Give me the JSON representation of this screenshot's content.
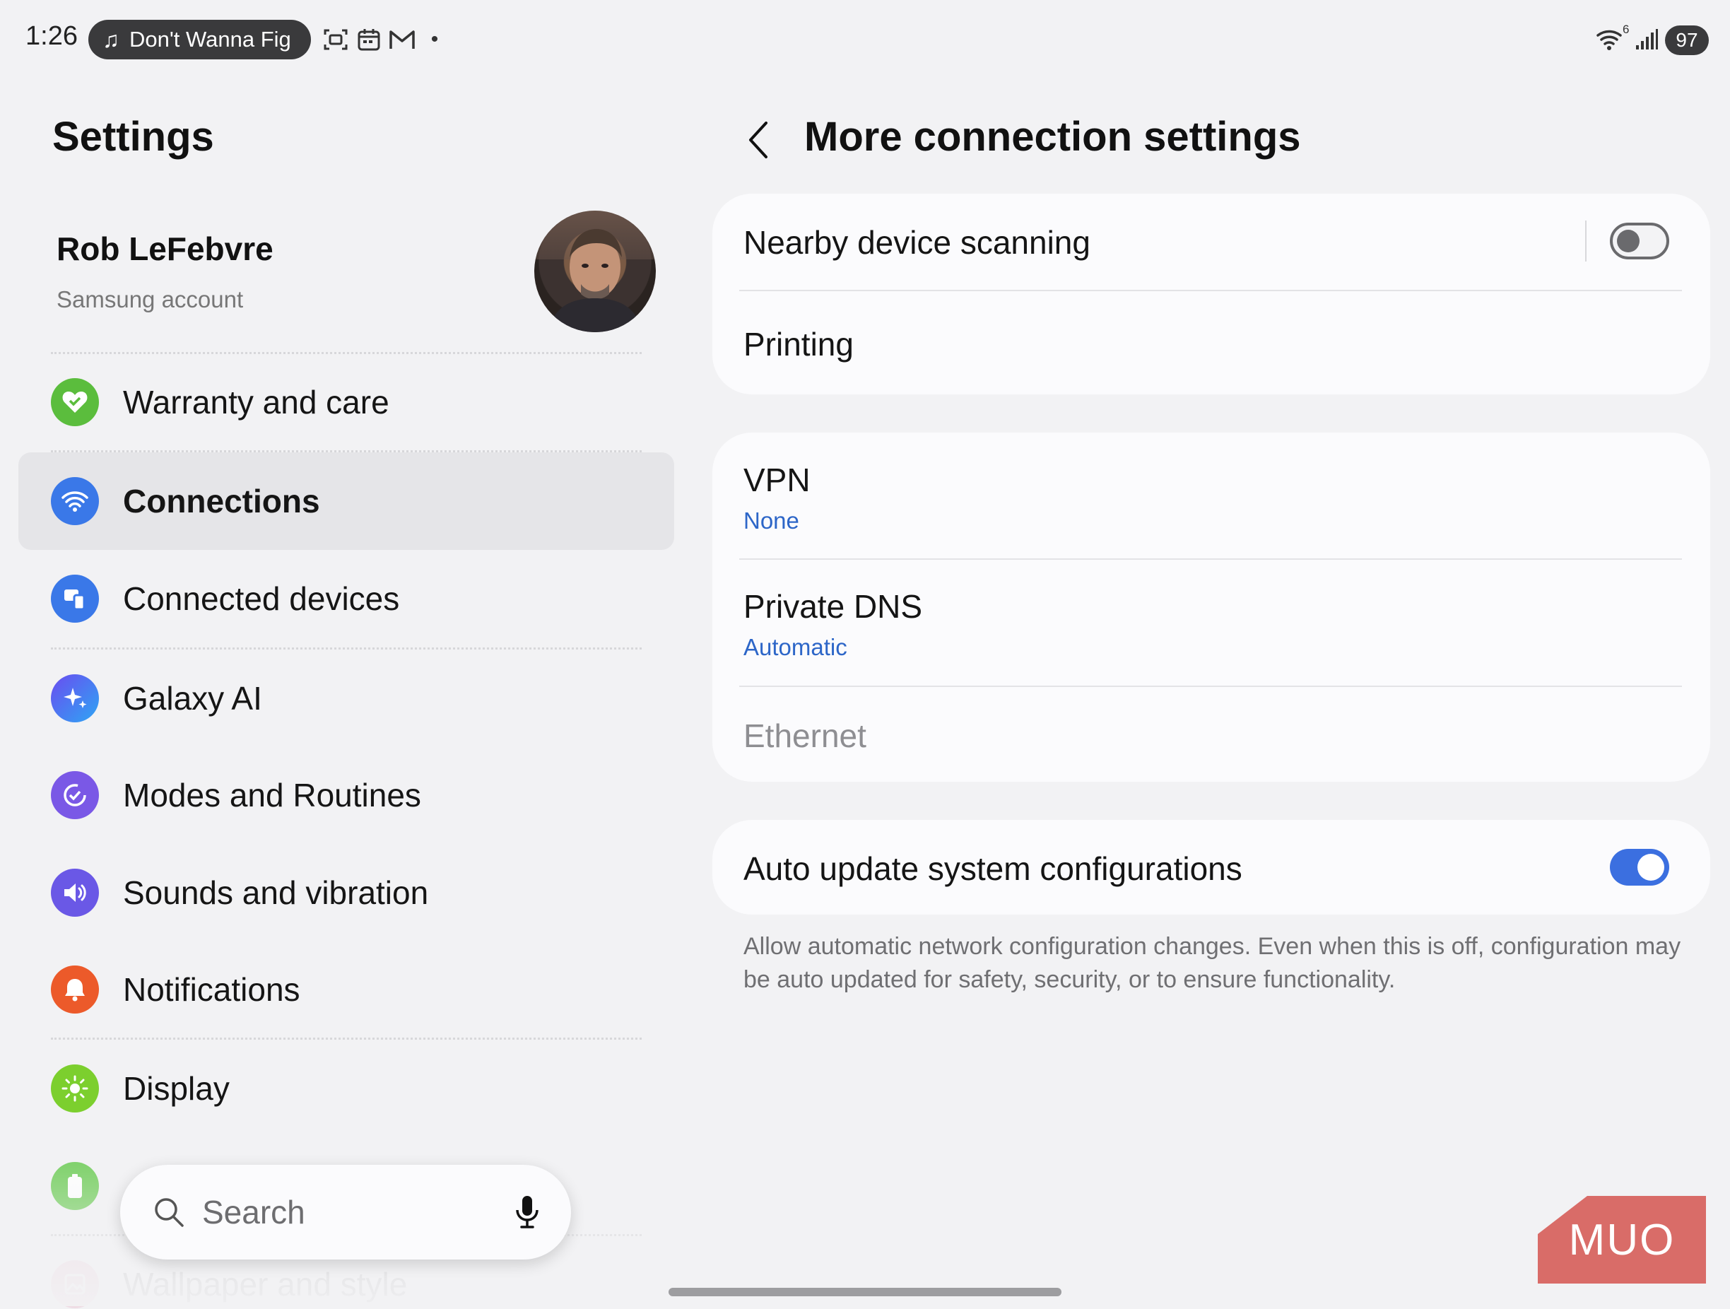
{
  "status_bar": {
    "time": "1:26",
    "media_track": "Don't Wanna Fig",
    "media_icon": "music-note-icon",
    "notification_icons": [
      "screenshot-icon",
      "calendar-icon",
      "gmail-icon"
    ],
    "dot": "•",
    "wifi_badge": "6",
    "battery": "97"
  },
  "left_pane": {
    "title": "Settings",
    "profile": {
      "name": "Rob LeFebvre",
      "subtitle": "Samsung account"
    },
    "menu": [
      {
        "label": "Warranty and care",
        "icon": "heart-icon",
        "color": "#5bbd3d",
        "selected": false
      },
      {
        "label": "Connections",
        "icon": "wifi-icon",
        "color": "#3a78e8",
        "selected": true
      },
      {
        "label": "Connected devices",
        "icon": "devices-icon",
        "color": "#3a78e8",
        "selected": false
      },
      {
        "label": "Galaxy AI",
        "icon": "sparkle-icon",
        "color": "#4b6cf0",
        "selected": false
      },
      {
        "label": "Modes and Routines",
        "icon": "check-circle-icon",
        "color": "#7a58e6",
        "selected": false
      },
      {
        "label": "Sounds and vibration",
        "icon": "speaker-icon",
        "color": "#6a58e6",
        "selected": false
      },
      {
        "label": "Notifications",
        "icon": "bell-icon",
        "color": "#ec5a2a",
        "selected": false
      },
      {
        "label": "Display",
        "icon": "sun-icon",
        "color": "#7ccf2e",
        "selected": false
      },
      {
        "label": "",
        "icon": "battery-icon",
        "color": "#6acb52",
        "selected": false
      },
      {
        "label": "Wallpaper and style",
        "icon": "wallpaper-icon",
        "color": "#e07ca0",
        "selected": false
      }
    ],
    "search": {
      "placeholder": "Search",
      "search_icon": "search-icon",
      "mic_icon": "microphone-icon"
    }
  },
  "right_pane": {
    "title": "More connection settings",
    "back_icon": "chevron-left-icon",
    "group1": {
      "nearby": {
        "label": "Nearby device scanning",
        "enabled": false
      },
      "printing": {
        "label": "Printing"
      }
    },
    "group2": {
      "vpn": {
        "label": "VPN",
        "value": "None"
      },
      "dns": {
        "label": "Private DNS",
        "value": "Automatic"
      },
      "ethernet": {
        "label": "Ethernet",
        "disabled": true
      }
    },
    "group3": {
      "auto_update": {
        "label": "Auto update system configurations",
        "enabled": true
      },
      "description": "Allow automatic network configuration changes. Even when this is off, configuration may be auto updated for safety, security, or to ensure functionality."
    }
  },
  "watermark": "MUO",
  "colors": {
    "accent": "#3b6fe0",
    "link": "#2d66c8",
    "background": "#f2f2f4",
    "card": "#fbfbfd"
  }
}
